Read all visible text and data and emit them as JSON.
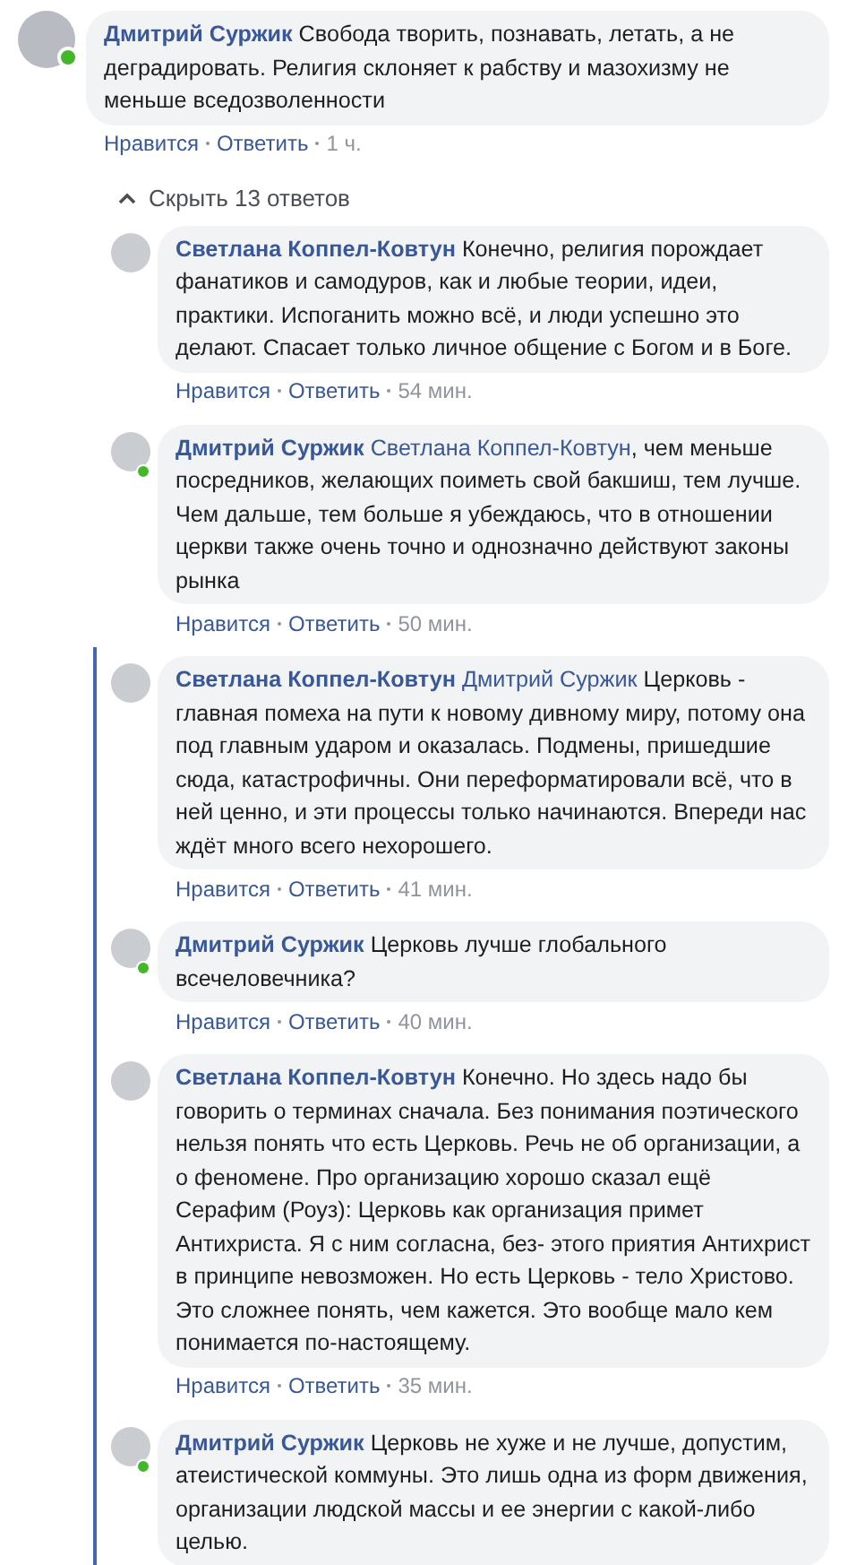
{
  "comment": {
    "author": "Дмитрий Суржик",
    "online": true,
    "text": "Свобода творить, познавать, летать, а не деградировать. Религия склоняет к рабству и мазохизму не меньше вседозволенности",
    "actions": [
      "Нравится",
      "Ответить"
    ],
    "time": "1 ч."
  },
  "replies_toggle": {
    "label": "Скрыть 13 ответов",
    "expanded": true
  },
  "replies": [
    {
      "author": "Светлана Коппел-Ковтун",
      "online": false,
      "thread_marked": false,
      "text": "Конечно, религия порождает фанатиков и самодуров, как и любые теории, идеи, практики. Испоганить можно всё, и люди успешно это делают. Спасает только личное общение с Богом и в Боге.",
      "actions": [
        "Нравится",
        "Ответить"
      ],
      "time": "54 мин."
    },
    {
      "author": "Дмитрий Суржик",
      "online": true,
      "thread_marked": false,
      "mention": "Светлана Коппел-Ковтун",
      "text": ", чем меньше посредников, желающих поиметь свой бакшиш, тем лучше. Чем дальше, тем больше я убеждаюсь, что в отношении церкви также очень точно и однозначно действуют законы рынка",
      "actions": [
        "Нравится",
        "Ответить"
      ],
      "time": "50 мин."
    },
    {
      "author": "Светлана Коппел-Ковтун",
      "online": false,
      "thread_marked": true,
      "mention": "Дмитрий Суржик",
      "text": " Церковь - главная помеха на пути к новому дивному миру, потому она под главным ударом и оказалась. Подмены, пришедшие сюда, катастрофичны. Они переформатировали всё, что в ней ценно, и эти процессы только начинаются. Впереди нас ждёт много всего нехорошего.",
      "actions": [
        "Нравится",
        "Ответить"
      ],
      "time": "41 мин."
    },
    {
      "author": "Дмитрий Суржик",
      "online": true,
      "thread_marked": true,
      "text": "Церковь лучше глобального всечеловечника?",
      "actions": [
        "Нравится",
        "Ответить"
      ],
      "time": "40 мин."
    },
    {
      "author": "Светлана Коппел-Ковтун",
      "online": false,
      "thread_marked": true,
      "text": "Конечно. Но здесь надо бы говорить о терминах сначала. Без понимания поэтического нельзя понять что есть Церковь. Речь не об организации, а о феномене. Про организацию хорошо сказал ещё Серафим (Роуз): Церковь как организация примет Антихриста. Я с ним согласна, без- этого приятия Антихрист в принципе невозможен. Но есть Церковь - тело Христово. Это сложнее понять, чем кажется. Это вообще мало кем понимается по-настоящему.",
      "actions": [
        "Нравится",
        "Ответить"
      ],
      "time": "35 мин."
    },
    {
      "author": "Дмитрий Суржик",
      "online": true,
      "thread_marked": true,
      "text": "Церковь не хуже и не лучше, допустим, атеистической коммуны. Это лишь одна из форм движения, организации людской массы и ее энергии с какой-либо целью."
    }
  ]
}
